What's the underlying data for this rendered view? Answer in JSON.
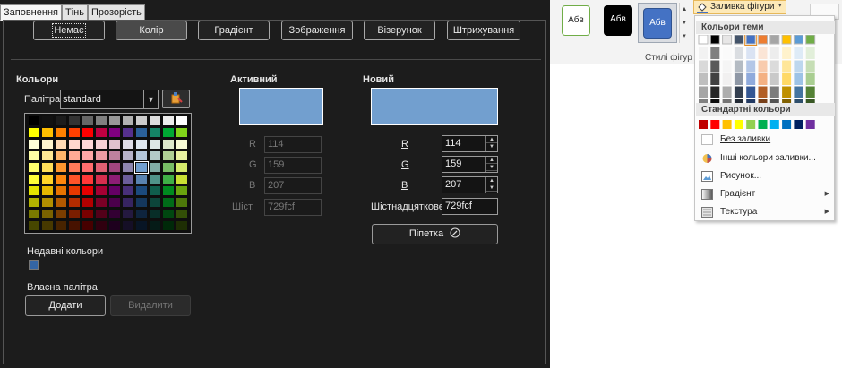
{
  "dialog": {
    "tabs": [
      "Заповнення",
      "Тінь",
      "Прозорість"
    ],
    "fill_buttons": [
      "Немає",
      "Колір",
      "Градієнт",
      "Зображення",
      "Візерунок",
      "Штрихування"
    ],
    "colors_label": "Кольори",
    "palette_label": "Палітра:",
    "palette_value": "standard",
    "recent_label": "Недавні кольори",
    "recent_color": "#3465a4",
    "custom_palette_label": "Власна палітра",
    "add_label": "Додати",
    "delete_label": "Видалити",
    "active": {
      "title": "Активний",
      "color": "#729fcf",
      "r_label": "R",
      "g_label": "G",
      "b_label": "B",
      "hex_label": "Шіст.",
      "r": "114",
      "g": "159",
      "b": "207",
      "hex": "729fcf"
    },
    "new": {
      "title": "Новий",
      "color": "#729fcf",
      "r_label": "R",
      "g_label": "G",
      "b_label": "B",
      "hex_label": "Шістнадцяткове",
      "r": "114",
      "g": "159",
      "b": "207",
      "hex": "729fcf"
    },
    "pipette_label": "Піпетка",
    "palette_colors": [
      [
        "#000000",
        "#111111",
        "#1c1c1c",
        "#333333",
        "#666666",
        "#808080",
        "#999999",
        "#b2b2b2",
        "#cccccc",
        "#dddddd",
        "#eeeeee",
        "#ffffff"
      ],
      [
        "#ffff00",
        "#ffbf00",
        "#ff8000",
        "#ff4000",
        "#ff0000",
        "#bf0041",
        "#800080",
        "#55308d",
        "#2a6099",
        "#158466",
        "#00a933",
        "#81d41a"
      ],
      [
        "#ffffd7",
        "#fff5ce",
        "#ffdbb6",
        "#ffd8ce",
        "#ffd7d7",
        "#f7d1d5",
        "#e0c2cd",
        "#dedce6",
        "#dee6ef",
        "#dee7e5",
        "#dde8cb",
        "#f6f9d4"
      ],
      [
        "#ffffa6",
        "#ffe994",
        "#ffb66c",
        "#ffaa95",
        "#ffa6a6",
        "#ec9ba4",
        "#bf819e",
        "#b7b3ca",
        "#b4c7dc",
        "#b3cac7",
        "#afd095",
        "#e8f2a1"
      ],
      [
        "#ffff6d",
        "#ffde59",
        "#ff972f",
        "#ff7b59",
        "#ff6d6d",
        "#e16173",
        "#a1467e",
        "#8e86ae",
        "#729fcf",
        "#81aca6",
        "#77bc65",
        "#d4ea6b"
      ],
      [
        "#ffff38",
        "#ffd428",
        "#ff860d",
        "#ff5429",
        "#ff3838",
        "#d62e4e",
        "#8d1d75",
        "#6b5e9b",
        "#5983b0",
        "#50938a",
        "#3faf46",
        "#c9e033"
      ],
      [
        "#e6e600",
        "#e6b800",
        "#e67300",
        "#e63800",
        "#e60000",
        "#a50033",
        "#650065",
        "#483079",
        "#1b4a7d",
        "#105e4d",
        "#008a1f",
        "#6aa40e"
      ],
      [
        "#b2b200",
        "#b28f00",
        "#b25900",
        "#b22c00",
        "#b20000",
        "#7b0026",
        "#4b004b",
        "#362460",
        "#14375d",
        "#0c453a",
        "#006b18",
        "#4d780a"
      ],
      [
        "#7a7a00",
        "#7a6200",
        "#7a3d00",
        "#7a1e00",
        "#7a0000",
        "#530019",
        "#330033",
        "#241940",
        "#0e243e",
        "#082e28",
        "#004710",
        "#334f07"
      ],
      [
        "#474700",
        "#473900",
        "#472300",
        "#471200",
        "#470000",
        "#30000f",
        "#1e001e",
        "#150f26",
        "#081525",
        "#051b17",
        "#002909",
        "#1e2e04"
      ]
    ]
  },
  "ribbon": {
    "style_sample": "Абв",
    "style_group_label": "Стилі фігур",
    "fill_button_label": "Заливка фігури",
    "menu": {
      "theme_header": "Кольори теми",
      "standard_header": "Стандартні кольори",
      "no_fill": "Без заливки",
      "more_colors": "Інші кольори заливки...",
      "picture": "Рисунок...",
      "gradient": "Градієнт",
      "texture": "Текстура",
      "theme_colors": [
        "#ffffff",
        "#000000",
        "#e7e6e6",
        "#44546a",
        "#4472c4",
        "#ed7d31",
        "#a5a5a5",
        "#ffc000",
        "#5b9bd5",
        "#70ad47"
      ],
      "standard_colors": [
        "#c00000",
        "#ff0000",
        "#ffc000",
        "#ffff00",
        "#92d050",
        "#00b050",
        "#00b0f0",
        "#0070c0",
        "#002060",
        "#7030a0"
      ]
    }
  }
}
